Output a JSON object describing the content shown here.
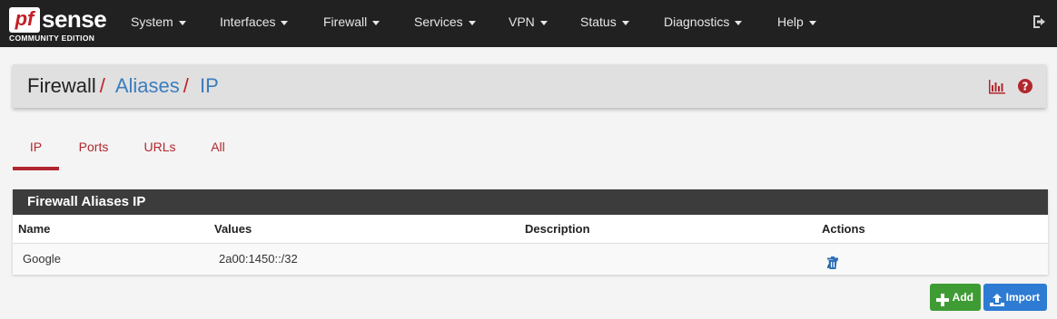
{
  "brand": {
    "logo_pf": "pf",
    "logo_sense": "sense",
    "edition": "COMMUNITY EDITION"
  },
  "nav": {
    "items": [
      {
        "label": "System"
      },
      {
        "label": "Interfaces"
      },
      {
        "label": "Firewall"
      },
      {
        "label": "Services"
      },
      {
        "label": "VPN"
      },
      {
        "label": "Status"
      },
      {
        "label": "Diagnostics"
      },
      {
        "label": "Help"
      }
    ],
    "logout_icon": "sign-out-icon"
  },
  "breadcrumb": {
    "items": [
      "Firewall",
      "Aliases",
      "IP"
    ],
    "separator": "/",
    "icons": [
      "chart-icon",
      "help-icon"
    ]
  },
  "tabs": {
    "items": [
      {
        "label": "IP",
        "active": true
      },
      {
        "label": "Ports",
        "active": false
      },
      {
        "label": "URLs",
        "active": false
      },
      {
        "label": "All",
        "active": false
      }
    ]
  },
  "panel": {
    "title": "Firewall Aliases IP",
    "columns": [
      "Name",
      "Values",
      "Description",
      "Actions"
    ],
    "rows": [
      {
        "name": "Google",
        "values": "2a00:1450::/32",
        "description": "",
        "actions": [
          "edit-icon",
          "delete-icon"
        ]
      }
    ]
  },
  "buttons": {
    "add_label": "Add",
    "import_label": "Import"
  },
  "colors": {
    "navbar": "#212121",
    "accent_red": "#b1272d",
    "link_blue": "#3b7dbe",
    "add_green": "#3f9c35",
    "import_blue": "#2d7bd2"
  }
}
